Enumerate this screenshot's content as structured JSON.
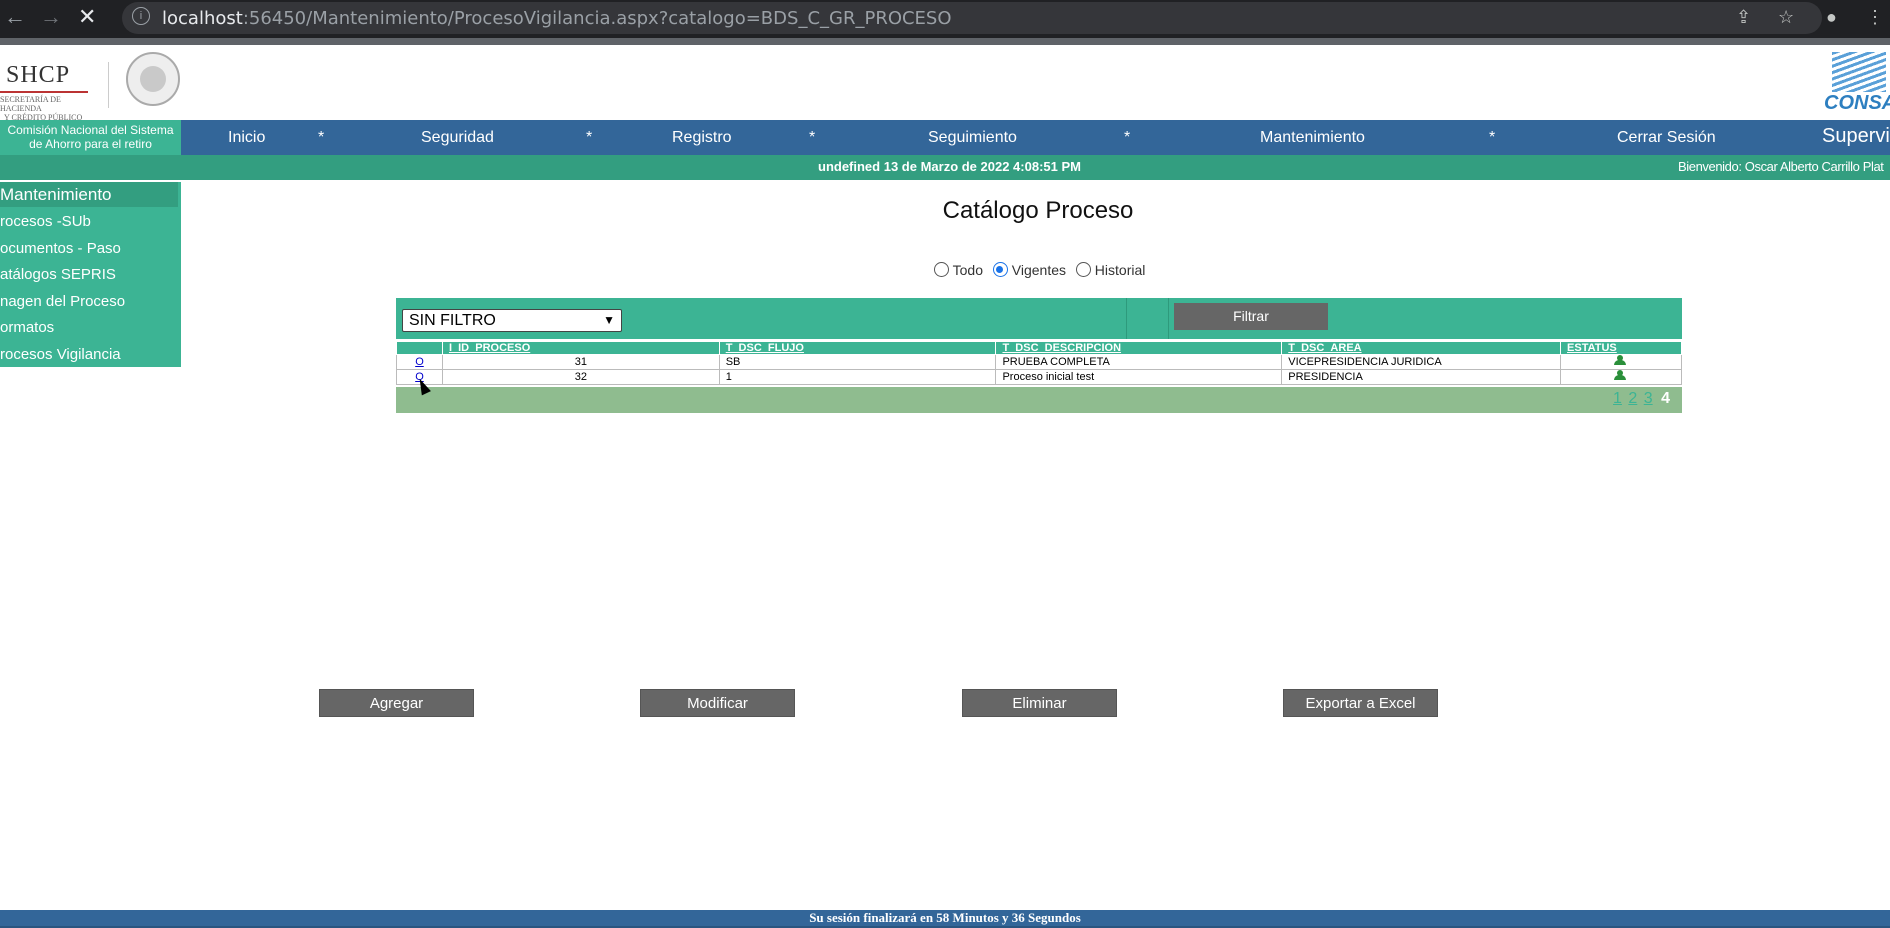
{
  "browser": {
    "url_host": "localhost",
    "url_path": ":56450/Mantenimiento/ProcesoVigilancia.aspx?catalogo=BDS_C_GR_PROCESO"
  },
  "header": {
    "shcp_logo": "SHCP",
    "shcp_subtitle_1": "SECRETARÍA DE HACIENDA",
    "shcp_subtitle_2": "Y CRÉDITO PÚBLICO",
    "consar_logo": "CONSAR",
    "org_name": "Comisión Nacional del Sistema de Ahorro para el retiro"
  },
  "menu": {
    "items": [
      "Inicio",
      "*",
      "Seguridad",
      "*",
      "Registro",
      "*",
      "Seguimiento",
      "*",
      "Mantenimiento",
      "*",
      "Cerrar Sesión"
    ],
    "right_label": "Supervi"
  },
  "datebar": {
    "date": "undefined 13 de Marzo de 2022 4:08:51 PM",
    "welcome": "Bienvenido: Oscar Alberto Carrillo Plat"
  },
  "sidebar": {
    "title": "Mantenimiento",
    "items": [
      "rocesos -SUb",
      "ocumentos - Paso",
      "atálogos SEPRIS",
      "nagen del Proceso",
      "ormatos",
      "rocesos Vigilancia"
    ]
  },
  "main": {
    "title": "Catálogo Proceso",
    "radios": [
      {
        "label": "Todo",
        "checked": false
      },
      {
        "label": "Vigentes",
        "checked": true
      },
      {
        "label": "Historial",
        "checked": false
      }
    ],
    "filter": {
      "selected": "SIN FILTRO",
      "button": "Filtrar"
    },
    "table": {
      "columns": [
        "",
        "I_ID_PROCESO",
        "T_DSC_FLUJO",
        "T_DSC_DESCRIPCION",
        "T_DSC_AREA",
        "ESTATUS"
      ],
      "rows": [
        {
          "select": "O",
          "id": "31",
          "flujo": "SB",
          "descripcion": "PRUEBA COMPLETA",
          "area": "VICEPRESIDENCIA JURIDICA",
          "status": "active-user-icon"
        },
        {
          "select": "O",
          "id": "32",
          "flujo": "1",
          "descripcion": "Proceso inicial test",
          "area": "PRESIDENCIA",
          "status": "active-user-icon"
        }
      ],
      "pager": {
        "pages": [
          "1",
          "2",
          "3"
        ],
        "current": "4"
      }
    },
    "actions": [
      "Agregar",
      "Modificar",
      "Eliminar",
      "Exportar a Excel"
    ]
  },
  "footer": {
    "session_text": "Su sesión finalizará en 58 Minutos y 36 Segundos"
  },
  "colors": {
    "menu_blue": "#336699",
    "green": "#3cb494",
    "dark_green": "#339e80",
    "pager_green": "#8fbc8f",
    "button_gray": "#666666"
  }
}
